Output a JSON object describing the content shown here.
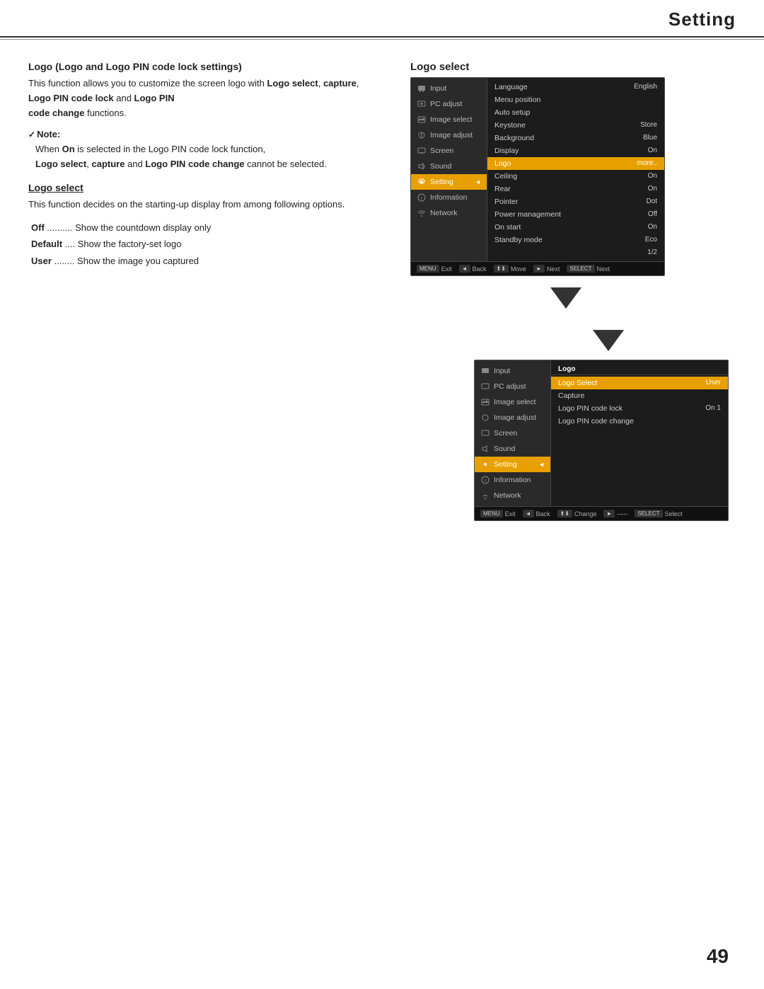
{
  "header": {
    "title": "Setting"
  },
  "page_number": "49",
  "left": {
    "heading1": "Logo (Logo and Logo PIN code lock settings)",
    "para1a": "This function allows you to customize the screen logo with ",
    "para1b": "Logo select",
    "para1c": ", ",
    "para1d": "capture",
    "para1e": ", ",
    "para1f": "Logo PIN code lock",
    "para1g": " and ",
    "para1h": "Logo PIN",
    "para1i": "code change",
    "para1j": " functions.",
    "note_label": "Note:",
    "note_text1": "When ",
    "note_on": "On",
    "note_text2": " is selected in the Logo PIN code lock function,",
    "note_bold1": "Logo select",
    "note_text3": ", ",
    "note_bold2": "capture",
    "note_text4": " and ",
    "note_bold3": "Logo PIN code change",
    "note_text5": " cannot be selected.",
    "logo_select_heading": "Logo select",
    "logo_select_desc": "This function decides on the starting-up display from among following options.",
    "options": [
      {
        "key": "Off",
        "dots": "..........",
        "desc": "Show the countdown display only"
      },
      {
        "key": "Default",
        "dots": "....",
        "desc": "Show the factory-set logo"
      },
      {
        "key": "User",
        "dots": "........",
        "desc": "Show the image you captured"
      }
    ]
  },
  "right": {
    "logo_select_title": "Logo select",
    "menu1": {
      "sidebar_items": [
        {
          "label": "Input",
          "icon": "⬛",
          "active": false
        },
        {
          "label": "PC adjust",
          "icon": "⬛",
          "active": false
        },
        {
          "label": "Image select",
          "icon": "⬛",
          "active": false
        },
        {
          "label": "Image adjust",
          "icon": "⬛",
          "active": false
        },
        {
          "label": "Screen",
          "icon": "⬛",
          "active": false
        },
        {
          "label": "Sound",
          "icon": "⬛",
          "active": false
        },
        {
          "label": "Setting",
          "icon": "⬛",
          "active": true
        },
        {
          "label": "Information",
          "icon": "⬛",
          "active": false
        },
        {
          "label": "Network",
          "icon": "⬛",
          "active": false
        }
      ],
      "main_items": [
        {
          "label": "Language",
          "value": "English",
          "highlighted": false
        },
        {
          "label": "Menu position",
          "value": "",
          "highlighted": false
        },
        {
          "label": "Auto setup",
          "value": "",
          "highlighted": false
        },
        {
          "label": "Keystone",
          "value": "Store",
          "highlighted": false
        },
        {
          "label": "Background",
          "value": "Blue",
          "highlighted": false
        },
        {
          "label": "Display",
          "value": "On",
          "highlighted": false
        },
        {
          "label": "Logo",
          "value": "more..",
          "highlighted": true
        },
        {
          "label": "Ceiling",
          "value": "On",
          "highlighted": false
        },
        {
          "label": "Rear",
          "value": "On",
          "highlighted": false
        },
        {
          "label": "Pointer",
          "value": "Dot",
          "highlighted": false
        },
        {
          "label": "Power management",
          "value": "Off",
          "highlighted": false
        },
        {
          "label": "On start",
          "value": "On",
          "highlighted": false
        },
        {
          "label": "Standby mode",
          "value": "Eco",
          "highlighted": false
        },
        {
          "label": "1/2",
          "value": "",
          "highlighted": false
        }
      ],
      "footer": [
        {
          "key": "MENU",
          "label": "Exit"
        },
        {
          "key": "◄",
          "label": "Back"
        },
        {
          "key": "⬆⬇",
          "label": "Move"
        },
        {
          "key": "►",
          "label": "Next"
        },
        {
          "key": "SELECT",
          "label": "Next"
        }
      ]
    },
    "menu2": {
      "sidebar_items": [
        {
          "label": "Input",
          "icon": "⬛",
          "active": false
        },
        {
          "label": "PC adjust",
          "icon": "⬛",
          "active": false
        },
        {
          "label": "Image select",
          "icon": "⬛",
          "active": false
        },
        {
          "label": "Image adjust",
          "icon": "⬛",
          "active": false
        },
        {
          "label": "Screen",
          "icon": "⬛",
          "active": false
        },
        {
          "label": "Sound",
          "icon": "⬛",
          "active": false
        },
        {
          "label": "Setting",
          "icon": "⬛",
          "active": true
        },
        {
          "label": "Information",
          "icon": "⬛",
          "active": false
        },
        {
          "label": "Network",
          "icon": "⬛",
          "active": false
        }
      ],
      "submenu_title": "Logo",
      "submenu_items": [
        {
          "label": "Logo Select",
          "value": "User",
          "highlighted": true
        },
        {
          "label": "Capture",
          "value": "",
          "highlighted": false
        },
        {
          "label": "Logo PIN code lock",
          "value": "On 1",
          "highlighted": false
        },
        {
          "label": "Logo PIN code change",
          "value": "",
          "highlighted": false
        }
      ],
      "footer": [
        {
          "key": "MENU",
          "label": "Exit"
        },
        {
          "key": "◄",
          "label": "Back"
        },
        {
          "key": "⬆⬇",
          "label": "Change"
        },
        {
          "key": "►",
          "label": "-----"
        },
        {
          "key": "SELECT",
          "label": "Select"
        }
      ]
    }
  }
}
